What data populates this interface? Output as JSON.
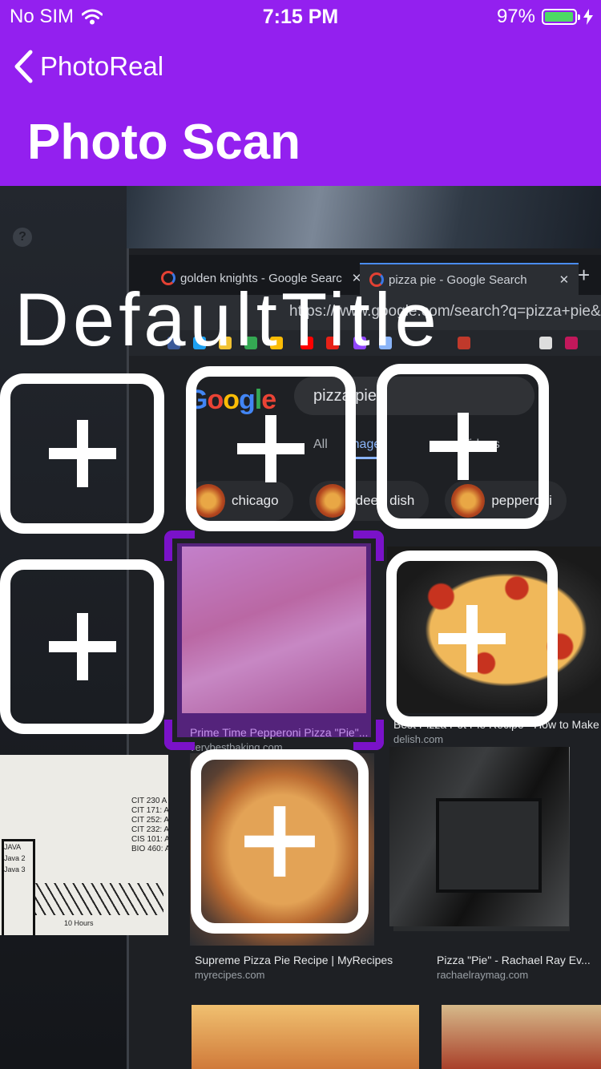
{
  "status_bar": {
    "carrier": "No SIM",
    "time": "7:15 PM",
    "battery": "97%",
    "battery_level": 0.97
  },
  "nav": {
    "back_label": "PhotoReal",
    "title": "Photo Scan"
  },
  "overlay": {
    "title": "DefaultTitle"
  },
  "browser": {
    "tabs": [
      "golden knights - Google Searc",
      "pizza pie - Google Search"
    ],
    "url": "https://www.google.com/search?q=pizza+pie&client",
    "search_query": "pizza pie",
    "nav_tabs": [
      "All",
      "Images",
      "Videos"
    ],
    "chips": [
      "chicago",
      "deep dish",
      "pepperoni"
    ],
    "results": [
      {
        "title": "Prime Time Pepperoni Pizza \"Pie\"...",
        "source": "verybestbaking.com"
      },
      {
        "title": "Best Pizza Pot Pie Recipe - How to Make ...",
        "source": "delish.com"
      },
      {
        "title": "Supreme Pizza Pie Recipe | MyRecipes",
        "source": "myrecipes.com"
      },
      {
        "title": "Pizza \"Pie\" - Rachael Ray Ev...",
        "source": "rachaelraymag.com"
      }
    ]
  },
  "whiteboard_lines": [
    "CIT 230 A",
    "CIT 171: A",
    "CIT 252: A",
    "CIT 232: A",
    "CIS 101: A",
    "BIO 460: A",
    "JAVA",
    "Java 2",
    "Java 3",
    "10 Hours"
  ],
  "photo_slots_label": "add-photo",
  "colors": {
    "header": "#9320ef",
    "scan_corner": "#7a12c9",
    "battery": "#4cd964"
  }
}
